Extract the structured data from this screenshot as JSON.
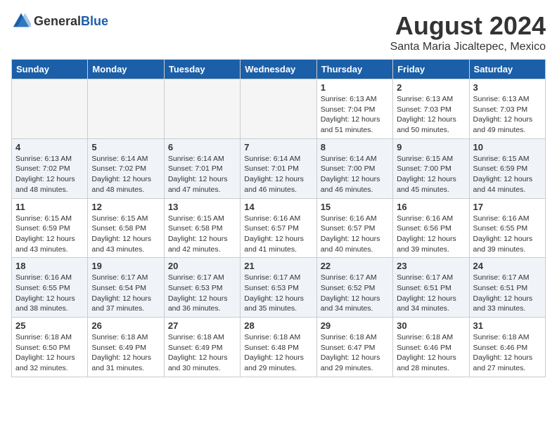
{
  "logo": {
    "text_general": "General",
    "text_blue": "Blue"
  },
  "title": {
    "month_year": "August 2024",
    "location": "Santa Maria Jicaltepec, Mexico"
  },
  "headers": [
    "Sunday",
    "Monday",
    "Tuesday",
    "Wednesday",
    "Thursday",
    "Friday",
    "Saturday"
  ],
  "weeks": [
    {
      "shaded": false,
      "days": [
        {
          "num": "",
          "content": ""
        },
        {
          "num": "",
          "content": ""
        },
        {
          "num": "",
          "content": ""
        },
        {
          "num": "",
          "content": ""
        },
        {
          "num": "1",
          "content": "Sunrise: 6:13 AM\nSunset: 7:04 PM\nDaylight: 12 hours and 51 minutes."
        },
        {
          "num": "2",
          "content": "Sunrise: 6:13 AM\nSunset: 7:03 PM\nDaylight: 12 hours and 50 minutes."
        },
        {
          "num": "3",
          "content": "Sunrise: 6:13 AM\nSunset: 7:03 PM\nDaylight: 12 hours and 49 minutes."
        }
      ]
    },
    {
      "shaded": true,
      "days": [
        {
          "num": "4",
          "content": "Sunrise: 6:13 AM\nSunset: 7:02 PM\nDaylight: 12 hours and 48 minutes."
        },
        {
          "num": "5",
          "content": "Sunrise: 6:14 AM\nSunset: 7:02 PM\nDaylight: 12 hours and 48 minutes."
        },
        {
          "num": "6",
          "content": "Sunrise: 6:14 AM\nSunset: 7:01 PM\nDaylight: 12 hours and 47 minutes."
        },
        {
          "num": "7",
          "content": "Sunrise: 6:14 AM\nSunset: 7:01 PM\nDaylight: 12 hours and 46 minutes."
        },
        {
          "num": "8",
          "content": "Sunrise: 6:14 AM\nSunset: 7:00 PM\nDaylight: 12 hours and 46 minutes."
        },
        {
          "num": "9",
          "content": "Sunrise: 6:15 AM\nSunset: 7:00 PM\nDaylight: 12 hours and 45 minutes."
        },
        {
          "num": "10",
          "content": "Sunrise: 6:15 AM\nSunset: 6:59 PM\nDaylight: 12 hours and 44 minutes."
        }
      ]
    },
    {
      "shaded": false,
      "days": [
        {
          "num": "11",
          "content": "Sunrise: 6:15 AM\nSunset: 6:59 PM\nDaylight: 12 hours and 43 minutes."
        },
        {
          "num": "12",
          "content": "Sunrise: 6:15 AM\nSunset: 6:58 PM\nDaylight: 12 hours and 43 minutes."
        },
        {
          "num": "13",
          "content": "Sunrise: 6:15 AM\nSunset: 6:58 PM\nDaylight: 12 hours and 42 minutes."
        },
        {
          "num": "14",
          "content": "Sunrise: 6:16 AM\nSunset: 6:57 PM\nDaylight: 12 hours and 41 minutes."
        },
        {
          "num": "15",
          "content": "Sunrise: 6:16 AM\nSunset: 6:57 PM\nDaylight: 12 hours and 40 minutes."
        },
        {
          "num": "16",
          "content": "Sunrise: 6:16 AM\nSunset: 6:56 PM\nDaylight: 12 hours and 39 minutes."
        },
        {
          "num": "17",
          "content": "Sunrise: 6:16 AM\nSunset: 6:55 PM\nDaylight: 12 hours and 39 minutes."
        }
      ]
    },
    {
      "shaded": true,
      "days": [
        {
          "num": "18",
          "content": "Sunrise: 6:16 AM\nSunset: 6:55 PM\nDaylight: 12 hours and 38 minutes."
        },
        {
          "num": "19",
          "content": "Sunrise: 6:17 AM\nSunset: 6:54 PM\nDaylight: 12 hours and 37 minutes."
        },
        {
          "num": "20",
          "content": "Sunrise: 6:17 AM\nSunset: 6:53 PM\nDaylight: 12 hours and 36 minutes."
        },
        {
          "num": "21",
          "content": "Sunrise: 6:17 AM\nSunset: 6:53 PM\nDaylight: 12 hours and 35 minutes."
        },
        {
          "num": "22",
          "content": "Sunrise: 6:17 AM\nSunset: 6:52 PM\nDaylight: 12 hours and 34 minutes."
        },
        {
          "num": "23",
          "content": "Sunrise: 6:17 AM\nSunset: 6:51 PM\nDaylight: 12 hours and 34 minutes."
        },
        {
          "num": "24",
          "content": "Sunrise: 6:17 AM\nSunset: 6:51 PM\nDaylight: 12 hours and 33 minutes."
        }
      ]
    },
    {
      "shaded": false,
      "days": [
        {
          "num": "25",
          "content": "Sunrise: 6:18 AM\nSunset: 6:50 PM\nDaylight: 12 hours and 32 minutes."
        },
        {
          "num": "26",
          "content": "Sunrise: 6:18 AM\nSunset: 6:49 PM\nDaylight: 12 hours and 31 minutes."
        },
        {
          "num": "27",
          "content": "Sunrise: 6:18 AM\nSunset: 6:49 PM\nDaylight: 12 hours and 30 minutes."
        },
        {
          "num": "28",
          "content": "Sunrise: 6:18 AM\nSunset: 6:48 PM\nDaylight: 12 hours and 29 minutes."
        },
        {
          "num": "29",
          "content": "Sunrise: 6:18 AM\nSunset: 6:47 PM\nDaylight: 12 hours and 29 minutes."
        },
        {
          "num": "30",
          "content": "Sunrise: 6:18 AM\nSunset: 6:46 PM\nDaylight: 12 hours and 28 minutes."
        },
        {
          "num": "31",
          "content": "Sunrise: 6:18 AM\nSunset: 6:46 PM\nDaylight: 12 hours and 27 minutes."
        }
      ]
    }
  ]
}
